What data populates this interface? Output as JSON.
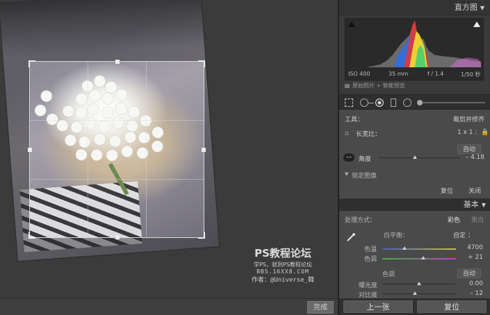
{
  "canvas": {
    "done_label": "完成",
    "watermark": {
      "line1": "PS教程论坛",
      "line2": "学PS，就到PS教程论坛",
      "line3": "BBS.16XX8.COM",
      "line4": "作者：@Universe_韓"
    }
  },
  "histogram": {
    "title": "直方图",
    "iso": "ISO 400",
    "focal": "35 mm",
    "aperture": "f / 1.4",
    "shutter": "1/50 秒",
    "preview_label": "原始照片 + 智能预览"
  },
  "crop": {
    "tool_label": "工具：",
    "tool_value": "裁剪并修齐",
    "aspect_label": "长宽比：",
    "aspect_value": "1 x 1 :",
    "auto_label": "自动",
    "angle_label": "角度",
    "angle_value": "– 4.18",
    "angle_level_percent": 45,
    "lock_label": "锁定图像",
    "reset_label": "复位",
    "close_label": "关闭"
  },
  "basic": {
    "title": "基本",
    "treatment_label": "处理方式：",
    "color_label": "彩色",
    "bw_label": "黑白",
    "wb_label": "白平衡：",
    "wb_value": "自定 ：",
    "temp_label": "色温",
    "temp_value": "4700",
    "temp_level_percent": 30,
    "tint_label": "色调",
    "tint_value": "+ 21",
    "tint_level_percent": 56,
    "tone_label": "色调",
    "tone_auto": "自动",
    "exposure_label": "曝光度",
    "exposure_value": "0.00",
    "exposure_level_percent": 50,
    "contrast_label": "对比度",
    "contrast_value": "– 12",
    "contrast_level_percent": 44
  },
  "bottom": {
    "prev_label": "上一张",
    "reset_label": "复位"
  }
}
